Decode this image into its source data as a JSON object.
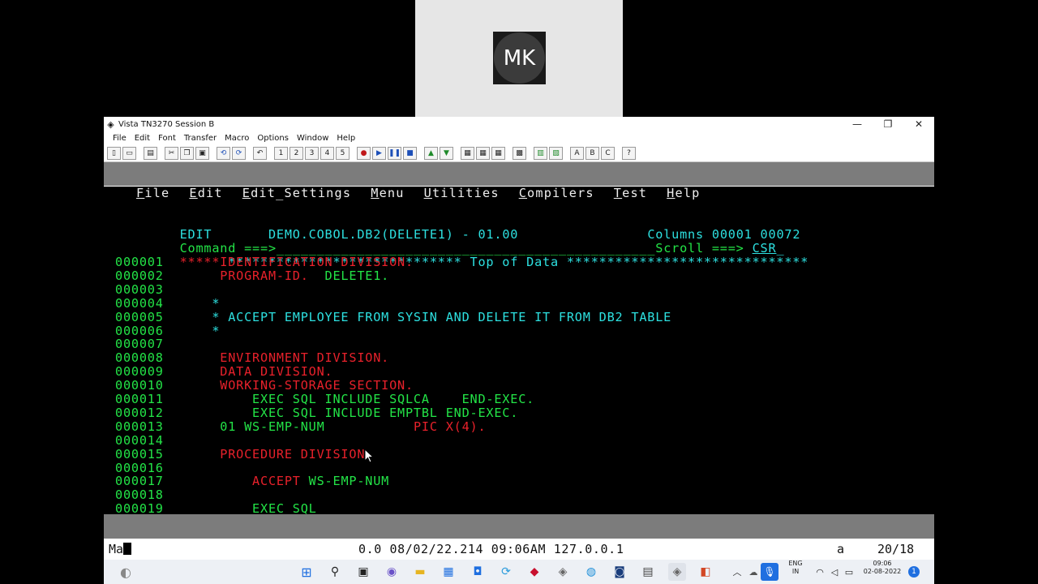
{
  "meeting": {
    "avatar_initials": "MK"
  },
  "window": {
    "title": "Vista TN3270 Session B",
    "controls": [
      "—",
      "❐",
      "✕"
    ],
    "menu": [
      "File",
      "Edit",
      "Font",
      "Transfer",
      "Macro",
      "Options",
      "Window",
      "Help"
    ],
    "toolbar_letters": [
      "A",
      "B",
      "C",
      "?"
    ]
  },
  "ispf": {
    "action_bar": [
      {
        "key": "F",
        "rest": "ile"
      },
      {
        "key": "E",
        "rest": "dit"
      },
      {
        "key": "E",
        "rest": "dit_Settings"
      },
      {
        "key": "M",
        "rest": "enu"
      },
      {
        "key": "U",
        "rest": "tilities"
      },
      {
        "key": "C",
        "rest": "ompilers"
      },
      {
        "key": "T",
        "rest": "est"
      },
      {
        "key": "H",
        "rest": "elp"
      }
    ],
    "mode": "EDIT",
    "dataset": "DEMO.COBOL.DB2(DELETE1) - 01.00",
    "columns_label": "Columns",
    "columns_value": "00001 00072",
    "command_label": "Command ===>",
    "command_value": "",
    "scroll_label": "Scroll ===>",
    "scroll_value": "CSR",
    "top_of_data": "***** ***************************** Top of Data ******************************",
    "lines": [
      {
        "num": "000001",
        "text": "       IDENTIFICATION DIVISION.",
        "color": "r"
      },
      {
        "num": "000002",
        "text": "       PROGRAM-ID.  DELETE1.",
        "color": "mix1"
      },
      {
        "num": "000003",
        "text": "",
        "color": "g"
      },
      {
        "num": "000004",
        "text": "      *",
        "color": "t"
      },
      {
        "num": "000005",
        "text": "      * ACCEPT EMPLOYEE FROM SYSIN AND DELETE IT FROM DB2 TABLE",
        "color": "t"
      },
      {
        "num": "000006",
        "text": "      *",
        "color": "t"
      },
      {
        "num": "000007",
        "text": "",
        "color": "g"
      },
      {
        "num": "000008",
        "text": "       ENVIRONMENT DIVISION.",
        "color": "r"
      },
      {
        "num": "000009",
        "text": "       DATA DIVISION.",
        "color": "r"
      },
      {
        "num": "000010",
        "text": "       WORKING-STORAGE SECTION.",
        "color": "r"
      },
      {
        "num": "000011",
        "text": "           EXEC SQL INCLUDE SQLCA    END-EXEC.",
        "color": "g"
      },
      {
        "num": "000012",
        "text": "           EXEC SQL INCLUDE EMPTBL END-EXEC.",
        "color": "g"
      },
      {
        "num": "000013",
        "text": "       01 WS-EMP-NUM           PIC X(4).",
        "color": "mix2"
      },
      {
        "num": "000014",
        "text": "",
        "color": "g"
      },
      {
        "num": "000015",
        "text": "       PROCEDURE DIVISION.",
        "color": "r"
      },
      {
        "num": "000016",
        "text": "",
        "color": "g"
      },
      {
        "num": "000017",
        "text": "           ACCEPT WS-EMP-NUM",
        "color": "mix3"
      },
      {
        "num": "000018",
        "text": "",
        "color": "g"
      },
      {
        "num": "000019",
        "text": "           EXEC SQL",
        "color": "g"
      }
    ]
  },
  "oia": {
    "left": "Ma",
    "middle": "0.0 08/02/22.214 09:06AM 127.0.0.1",
    "indicator": "a",
    "position": "20/18"
  },
  "taskbar": {
    "lang_top": "ENG",
    "lang_bottom": "IN",
    "time": "09:06",
    "date": "02-08-2022",
    "notif_count": "1"
  }
}
